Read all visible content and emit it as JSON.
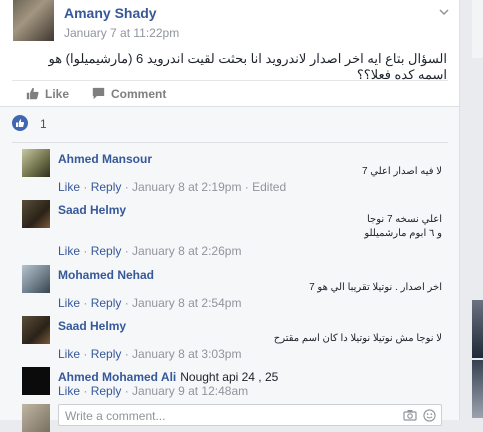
{
  "post": {
    "author": "Amany Shady",
    "time": "January 7 at 11:22pm",
    "text": "السؤال بتاع ايه اخر اصدار لاندرويد انا بحثت لقيت اندرويد 6 (مارشيميلوا) هو اسمه كده فعلا؟؟"
  },
  "actions": {
    "like": "Like",
    "comment": "Comment"
  },
  "reactions": {
    "count": "1"
  },
  "comments": [
    {
      "name": "Ahmed Mansour",
      "text": "لا فيه اصدار اعلي 7",
      "like": "Like",
      "reply": "Reply",
      "time": "January 8 at 2:19pm",
      "edited": "Edited"
    },
    {
      "name": "Saad Helmy",
      "text_line1": "اعلي نسخه 7 نوجا",
      "text_line2": "و ٦ ابوم مارشميللو",
      "like": "Like",
      "reply": "Reply",
      "time": "January 8 at 2:26pm"
    },
    {
      "name": "Mohamed Nehad",
      "text": "اخر اصدار . نوتيلا تقريبا الي هو 7",
      "like": "Like",
      "reply": "Reply",
      "time": "January 8 at 2:54pm"
    },
    {
      "name": "Saad Helmy",
      "text": "لا نوجا مش نوتيلا نوتيلا دا كان اسم مقترح",
      "like": "Like",
      "reply": "Reply",
      "time": "January 8 at 3:03pm"
    },
    {
      "name": "Ahmed Mohamed Ali",
      "text": "Nought api 24 , 25",
      "like": "Like",
      "reply": "Reply",
      "time": "January 9 at 12:48am"
    }
  ],
  "write_comment": {
    "placeholder": "Write a comment..."
  },
  "colors": {
    "link": "#365899",
    "meta": "#90949c",
    "like_blue": "#4267b2"
  }
}
